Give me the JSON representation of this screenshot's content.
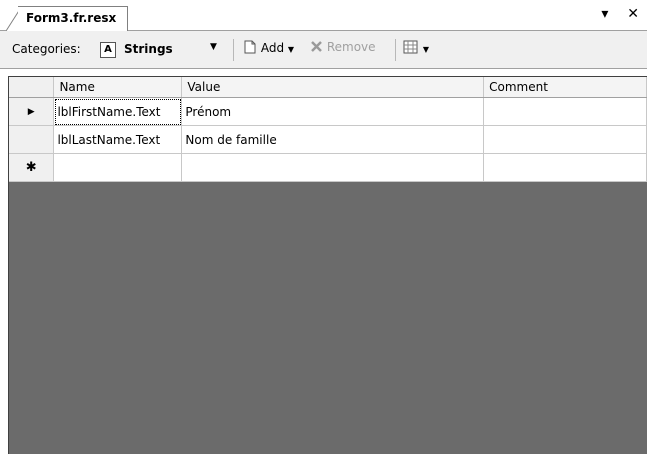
{
  "tab": {
    "title": "Form3.fr.resx"
  },
  "window_controls": {
    "pin": "▾",
    "close": "✕"
  },
  "toolbar": {
    "categories_label": "Categories:",
    "category_value": "Strings",
    "category_icon_glyph": "A",
    "combo_arrow": "▼",
    "add_label": "Add",
    "add_arrow": "▼",
    "remove_label": "Remove",
    "view_arrow": "▼"
  },
  "grid": {
    "columns": [
      "Name",
      "Value",
      "Comment"
    ],
    "rows": [
      {
        "indicator": "▶",
        "name": "lblFirstName.Text",
        "value": "Prénom",
        "comment": ""
      },
      {
        "indicator": "",
        "name": "lblLastName.Text",
        "value": "Nom de famille",
        "comment": ""
      },
      {
        "indicator": "✱",
        "name": "",
        "value": "",
        "comment": ""
      }
    ]
  }
}
